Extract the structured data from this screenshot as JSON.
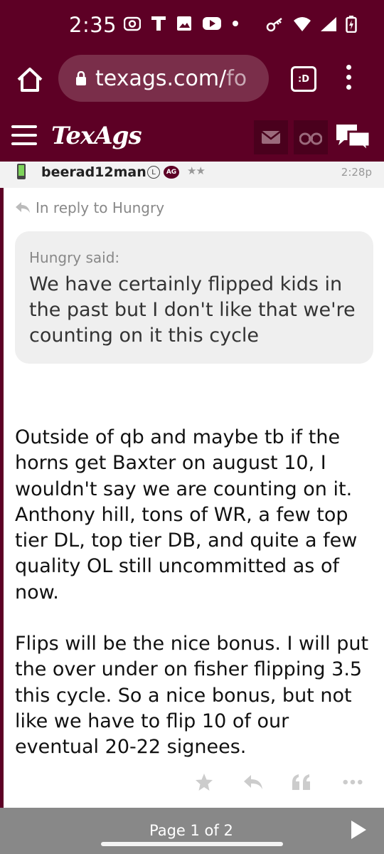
{
  "status_bar": {
    "time": "2:35",
    "left_icons": [
      "camera-icon",
      "t-app-icon",
      "image-icon",
      "youtube-icon",
      "dot-icon"
    ],
    "right_icons": [
      "key-icon",
      "wifi-icon",
      "signal-icon",
      "battery-charging-icon"
    ]
  },
  "browser": {
    "url_main": "texags.com/",
    "url_faded": "fo",
    "tab_badge": ":D"
  },
  "site": {
    "logo": "TexAgs",
    "brand_color": "#5d0025"
  },
  "post": {
    "username": "beerad12man",
    "badge_l": "L",
    "badge_ag": "AG",
    "stars": "★★",
    "time": "2:28p",
    "reply_to": "In reply to Hungry",
    "quote_author": "Hungry said:",
    "quote_text": "We have certainly flipped kids in the past but I don't like that we're counting on it this cycle",
    "body_p1": "Outside of qb and maybe tb if the horns get Baxter on august 10, I wouldn't say we are counting on it. Anthony hill, tons of WR, a few top tier DL, top tier DB, and quite a few quality OL still uncommitted as of now.",
    "body_p2": "Flips will be the nice bonus. I will put the over under on fisher flipping 3.5 this cycle. So a nice bonus, but not like we have to flip 10 of our eventual 20-22 signees."
  },
  "actions": [
    "star-icon",
    "reply-icon",
    "quote-icon",
    "more-icon"
  ],
  "pager": {
    "label": "Page 1 of 2"
  }
}
